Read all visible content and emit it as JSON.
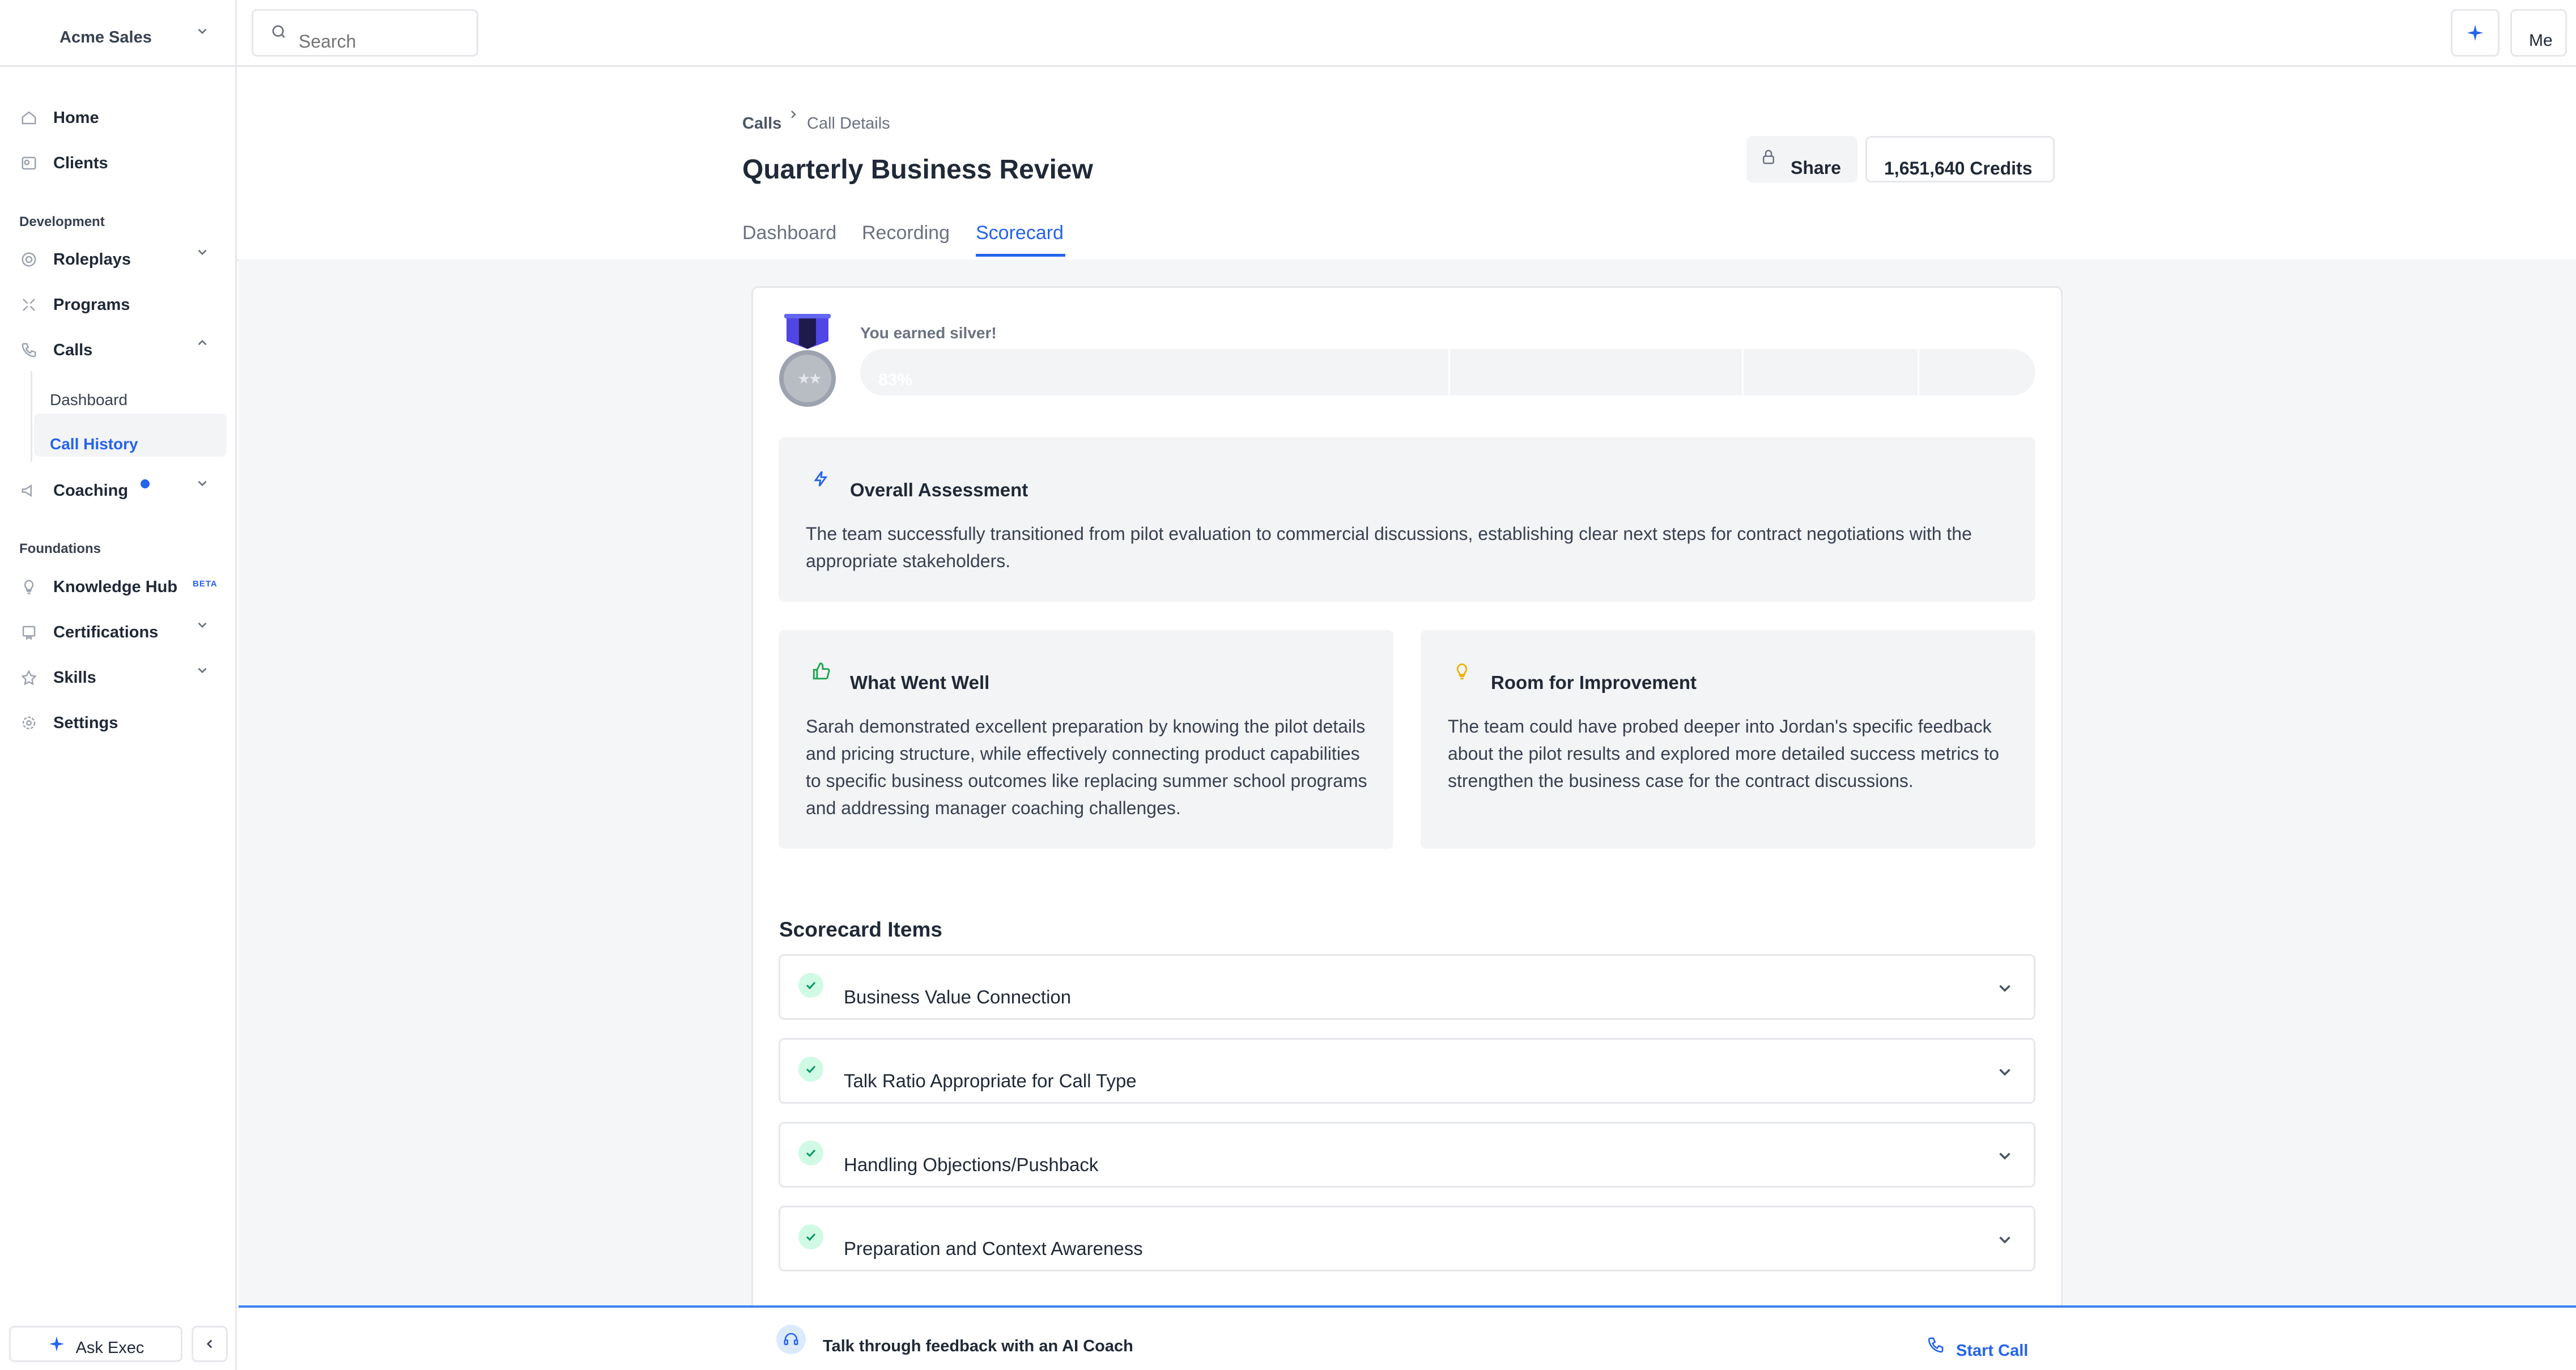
{
  "workspace": {
    "name": "Acme Sales"
  },
  "search": {
    "placeholder": "Search"
  },
  "topbar": {
    "user_label": "Me"
  },
  "sidebar": {
    "home": "Home",
    "clients": "Clients",
    "section_development": "Development",
    "roleplays": "Roleplays",
    "programs": "Programs",
    "calls": "Calls",
    "calls_sub": {
      "dashboard": "Dashboard",
      "call_history": "Call History"
    },
    "coaching": "Coaching",
    "section_foundations": "Foundations",
    "knowledge_hub": "Knowledge Hub",
    "knowledge_hub_badge": "BETA",
    "certifications": "Certifications",
    "skills": "Skills",
    "settings": "Settings",
    "ask_exec": "Ask Exec"
  },
  "breadcrumb": {
    "parent": "Calls",
    "current": "Call Details"
  },
  "page": {
    "title": "Quarterly Business Review",
    "share_label": "Share",
    "credits_label": "1,651,640 Credits",
    "tabs": [
      {
        "label": "Dashboard",
        "active": false
      },
      {
        "label": "Recording",
        "active": false
      },
      {
        "label": "Scorecard",
        "active": true
      }
    ]
  },
  "score": {
    "earned_text": "You earned silver!",
    "percent_label": "83%",
    "percent_value": 0.83,
    "medal": "silver-medal-icon"
  },
  "overall": {
    "title": "Overall Assessment",
    "body": "The team successfully transitioned from pilot evaluation to commercial discussions, establishing clear next steps for contract negotiations with the appropriate stakeholders."
  },
  "went_well": {
    "title": "What Went Well",
    "body": "Sarah demonstrated excellent preparation by knowing the pilot details and pricing structure, while effectively connecting product capabilities to specific business outcomes like replacing summer school programs and addressing manager coaching challenges."
  },
  "improvement": {
    "title": "Room for Improvement",
    "body": "The team could have probed deeper into Jordan's specific feedback about the pilot results and explored more detailed success metrics to strengthen the business case for the contract discussions."
  },
  "scorecard": {
    "title": "Scorecard Items",
    "items": [
      {
        "label": "Business Value Connection",
        "status": "passed"
      },
      {
        "label": "Talk Ratio Appropriate for Call Type",
        "status": "passed"
      },
      {
        "label": "Handling Objections/Pushback",
        "status": "passed"
      },
      {
        "label": "Preparation and Context Awareness",
        "status": "passed"
      }
    ]
  },
  "footer": {
    "coach_text": "Talk through feedback with an AI Coach",
    "start_call": "Start Call"
  },
  "colors": {
    "accent": "#2563eb",
    "success": "#10b981",
    "warning": "#eab308"
  }
}
